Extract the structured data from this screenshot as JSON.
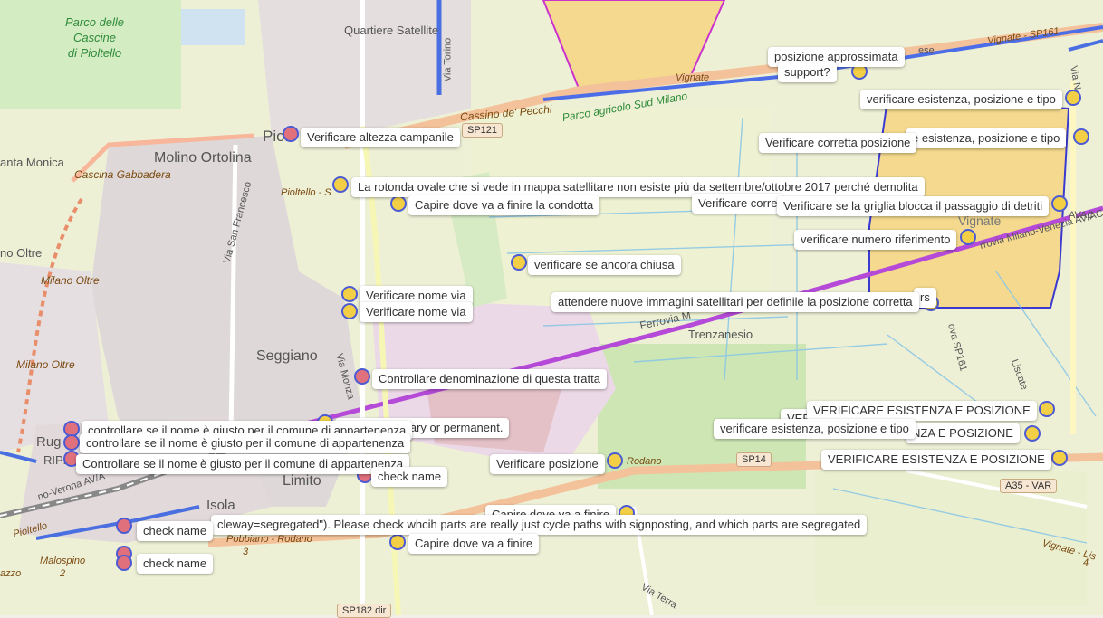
{
  "map": {
    "places": {
      "parco_cascine": "Parco delle\nCascine\ndi Pioltello",
      "quartiere_satellite": "Quartiere Satellite",
      "pioltello_partial": "Piol",
      "molino_ortolina": "Molino Ortolina",
      "santa_monica": "anta Monica",
      "cascina_gabbadera": "Cascina Gabbadera",
      "no_oltre": "no Oltre",
      "milano_oltre_1": "Milano Oltre",
      "milano_oltre_2": "Milano Oltre",
      "seggiano": "Seggiano",
      "limito": "Limito",
      "isola": "Isola",
      "trenzanesio": "Trenzanesio",
      "vignate_1": "Vignate",
      "vignate_2": "Vignate",
      "ruga": "Rug",
      "ripp": "RIPP",
      "cassino_de_pecchi": "Cassino de' Pecchi",
      "parco_agricolo": "Parco agricolo Sud Milano",
      "pioltello_s": "Pioltello - S",
      "via_torino": "Via Torino",
      "via_san_francesco": "Via San Francesco",
      "via_monza": "Via Monza",
      "ferrovia": "Ferrovia M",
      "rodano": "Rodano",
      "pobbiano_rodano": "Pobbiano - Rodano",
      "malospino": "Malospino",
      "pioltello_sw": "Pioltello",
      "via_terra": "Via Terra",
      "liscate": "Liscate",
      "vignate_lis": "Vignate - Lis",
      "ferrovia_milano": "rrovia Milano-Venezia AV/AC",
      "vignate_sp161_road": "Vignate - SP161",
      "milano_verona": "no-Verona AV/A",
      "azzo": "azzo",
      "digit_2a": "2",
      "digit_3": "3",
      "digit_4": "4",
      "nuova_sp161": "ova SP161",
      "via_n": "Via N",
      "lese": "ese",
      "avac": "AVAC"
    },
    "shields": {
      "sp121": "SP121",
      "sp14": "SP14",
      "a35": "A35 - VAR",
      "sp182": "SP182 dir",
      "sp161": "SP161"
    }
  },
  "notes": [
    {
      "text": "posizione approssimata"
    },
    {
      "text": "support?"
    },
    {
      "text": "verificare esistenza, posizione e tipo"
    },
    {
      "text": "Verificare altezza campanile"
    },
    {
      "text": "Verificare corretta posizione"
    },
    {
      "text": "e esistenza, posizione e tipo"
    },
    {
      "text": "La rotonda ovale che si vede in mappa satellitare non esiste più da settembre/ottobre 2017 perché demolita"
    },
    {
      "text": "Capire dove va a finire la condotta"
    },
    {
      "text": "Verificare corre"
    },
    {
      "text": "Verificare se la griglia blocca il passaggio di detriti"
    },
    {
      "text": "verificare numero riferimento"
    },
    {
      "text": "verificare se ancora chiusa"
    },
    {
      "text": "Verificare nome via"
    },
    {
      "text": "Verificare nome via"
    },
    {
      "text": "rs"
    },
    {
      "text": "attendere nuove immagini satellitari per definile la posizione corretta"
    },
    {
      "text": "Controllare denominazione di questa tratta"
    },
    {
      "text": "VERIFICARE ESISTENZA E POSIZIONE"
    },
    {
      "text": "VEF"
    },
    {
      "text": "ure is temporary or permanent."
    },
    {
      "text": "controllare se il nome è giusto per il comune di appartenenza"
    },
    {
      "text": "controllare se il nome è giusto per il comune di appartenenza"
    },
    {
      "text": "verificare esistenza, posizione e tipo"
    },
    {
      "text": "NZA E POSIZIONE"
    },
    {
      "text": "Controllare se il nome è giusto per il comune di appartenenza"
    },
    {
      "text": "check name"
    },
    {
      "text": "Verificare posizione"
    },
    {
      "text": "VERIFICARE ESISTENZA E POSIZIONE"
    },
    {
      "text": "Capire dove va a finire"
    },
    {
      "text": "cleway=segregated\"). Please check whcih parts are really just cycle paths with signposting, and which parts are segregated"
    },
    {
      "text": "check name"
    },
    {
      "text": "Capire dove va a finire"
    },
    {
      "text": "check name"
    }
  ]
}
